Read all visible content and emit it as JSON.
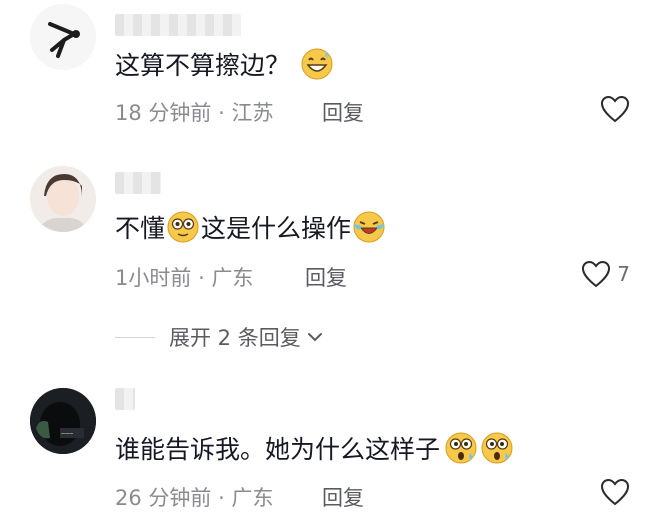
{
  "comments": [
    {
      "text_parts": [
        "这算不算擦边？"
      ],
      "time": "18 分钟前",
      "location": "江苏",
      "reply_label": "回复",
      "likes": ""
    },
    {
      "text_parts": [
        "不懂",
        "这是什么操作"
      ],
      "time": "1小时前",
      "location": "广东",
      "reply_label": "回复",
      "likes": "7"
    },
    {
      "text_parts": [
        "谁能告诉我。她为什么这样子"
      ],
      "time": "26 分钟前",
      "location": "广东",
      "reply_label": "回复",
      "likes": ""
    }
  ],
  "expand_replies": {
    "label": "展开 2 条回复",
    "icon": "chevron-down-icon"
  },
  "separator": "·",
  "colors": {
    "text": "#161823",
    "meta": "#8a8b91",
    "emoji_yellow": "#f7c94a"
  }
}
